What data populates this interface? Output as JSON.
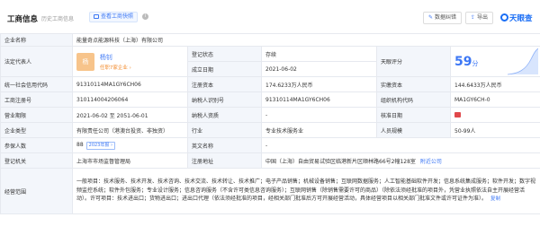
{
  "header": {
    "title": "工商信息",
    "history_link": "历史工商信息",
    "photo_button": "查看工商快照",
    "info_icon": "i",
    "data_correction": "数据纠错",
    "export": "导出",
    "brand": "天眼查",
    "colors": {
      "accent": "#3c77f5",
      "brand": "#1a6ef5"
    }
  },
  "company": {
    "name_label": "企业名称",
    "name": "能量奇点能源科技（上海）有限公司",
    "legal_label": "法定代表人",
    "legal_avatar": "杨",
    "legal_name": "杨钊",
    "legal_sub": "任职7家企业 ›",
    "status_label": "登记状态",
    "status": "存续",
    "founded_label": "成立日期",
    "founded": "2021-06-02",
    "score_label": "天眼评分",
    "score_value": "59",
    "score_unit": "分",
    "credit_label": "统一社会信用代码",
    "credit_code": "91310114MA1GY6CH06",
    "reg_capital_label": "注册资本",
    "reg_capital": "174.6233万人民币",
    "paid_capital_label": "实缴资本",
    "paid_capital": "144.6433万人民币",
    "biz_reg_label": "工商注册号",
    "biz_reg": "310114004206064",
    "tax_id_label": "纳税人识别号",
    "tax_id": "91310114MA1GY6CH06",
    "org_code_label": "组织机构代码",
    "org_code": "MA1GY6CH-0",
    "term_label": "营业期限",
    "term": "2021-06-02 至 2051-06-01",
    "taxpayer_label": "纳税人资质",
    "taxpayer": "-",
    "approval_label": "核准日期",
    "type_label": "企业类型",
    "type": "有限责任公司（港澳台投资、非独资）",
    "industry_label": "行业",
    "industry": "专业技术服务业",
    "staff_label": "人员规模",
    "staff": "50-99人",
    "insured_label": "参保人数",
    "insured": "88",
    "insured_badge": "2023年报 ›",
    "en_name_label": "英文名称",
    "en_name": "-",
    "authority_label": "登记机关",
    "authority": "上海市市场监督管理局",
    "address_label": "注册地址",
    "address": "中国（上海）自由贸易试验区临港新片区顺林路66号2幢128室",
    "nearby": "附近公司",
    "scope_label": "经营范围",
    "scope": "一般项目：技术服务、技术开发、技术咨询、技术交流、技术转让、技术推广；电子产品销售；机械设备销售；互联网数据服务；人工智能基础软件开发；信息系统集成服务；软件开发；数字视频监控系统；软件外包服务；专业设计服务；信息咨询服务（不含许可类信息咨询服务）；互联网销售（除销售需要许可的商品）（除依法须经批准的项目外，凭营业执照依法自主开展经营活动）。许可项目：技术进出口；货物进出口；进出口代理（依法须经批准的项目，经相关部门批准后方可开展经营活动，具体经营项目以相关部门批准文件或许可证件为准）。",
    "copy": "复制"
  }
}
